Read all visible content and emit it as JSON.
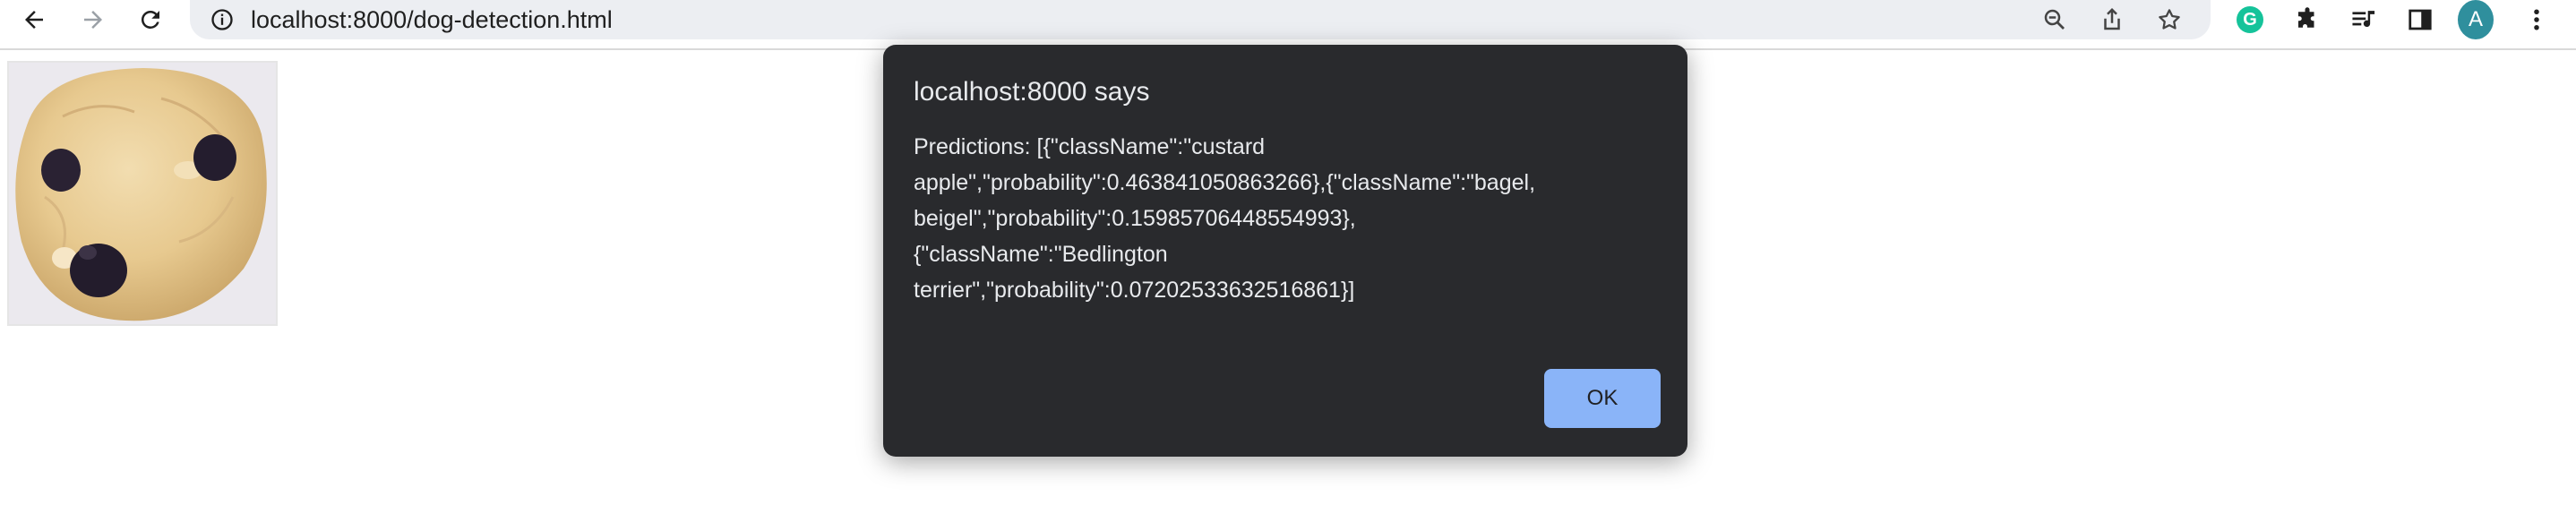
{
  "browser": {
    "url": "localhost:8000/dog-detection.html",
    "profile_initial": "A",
    "icons": {
      "back": "back-arrow-icon",
      "forward": "forward-arrow-icon",
      "reload": "reload-icon",
      "site_info": "site-info-icon",
      "zoom": "zoom-out-icon",
      "share": "share-icon",
      "bookmark": "bookmark-star-icon",
      "grammarly": "grammarly-extension-icon",
      "extensions": "puzzle-extensions-icon",
      "media": "media-controls-icon",
      "side_panel": "side-panel-icon",
      "menu": "kebab-menu-icon"
    },
    "grammarly_letter": "G",
    "colors": {
      "omnibox": "#eceef2",
      "avatar": "#2f8f9d",
      "grammarly": "#15c39a"
    }
  },
  "page": {
    "image_subject": "muffin-photo"
  },
  "dialog": {
    "title": "localhost:8000 says",
    "message_lines": [
      "Predictions: [{\"className\":\"custard",
      "apple\",\"probability\":0.463841050863266},{\"className\":\"bagel,",
      "beigel\",\"probability\":0.15985706448554993},",
      "{\"className\":\"Bedlington",
      "terrier\",\"probability\":0.07202533632516861}]"
    ],
    "ok_label": "OK",
    "colors": {
      "background": "#292a2d",
      "button": "#8ab4f8"
    }
  }
}
